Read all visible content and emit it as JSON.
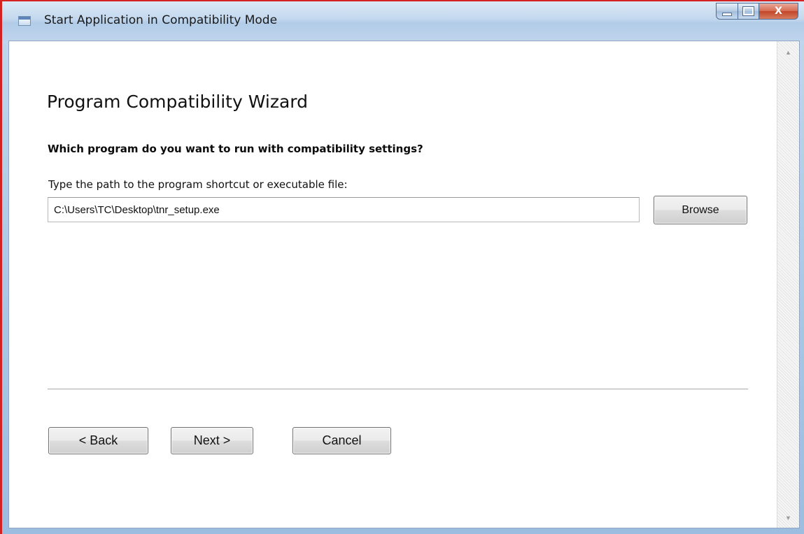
{
  "window": {
    "title": "Start Application in Compatibility Mode",
    "controls": {
      "minimize_icon": "minimize-icon",
      "maximize_icon": "maximize-icon",
      "close_label": "X"
    }
  },
  "wizard": {
    "heading": "Program Compatibility Wizard",
    "question": "Which program do you want to run with compatibility settings?",
    "path_label": "Type the path to the program shortcut or executable file:",
    "path_value": "C:\\Users\\TC\\Desktop\\tnr_setup.exe",
    "browse_label": "Browse"
  },
  "buttons": {
    "back_label": "< Back",
    "next_label": "Next >",
    "cancel_label": "Cancel"
  },
  "colors": {
    "window_frame_accent": "#d42222",
    "title_bar": "#c3d8ee",
    "close_button": "#c24528",
    "client_background": "#ffffff"
  }
}
